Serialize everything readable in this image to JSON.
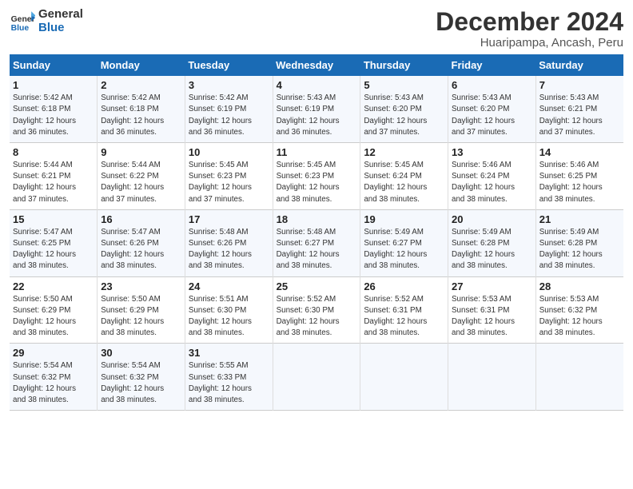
{
  "header": {
    "logo_line1": "General",
    "logo_line2": "Blue",
    "month_title": "December 2024",
    "location": "Huaripampa, Ancash, Peru"
  },
  "days_of_week": [
    "Sunday",
    "Monday",
    "Tuesday",
    "Wednesday",
    "Thursday",
    "Friday",
    "Saturday"
  ],
  "weeks": [
    [
      {
        "day": "1",
        "info": "Sunrise: 5:42 AM\nSunset: 6:18 PM\nDaylight: 12 hours\nand 36 minutes."
      },
      {
        "day": "2",
        "info": "Sunrise: 5:42 AM\nSunset: 6:18 PM\nDaylight: 12 hours\nand 36 minutes."
      },
      {
        "day": "3",
        "info": "Sunrise: 5:42 AM\nSunset: 6:19 PM\nDaylight: 12 hours\nand 36 minutes."
      },
      {
        "day": "4",
        "info": "Sunrise: 5:43 AM\nSunset: 6:19 PM\nDaylight: 12 hours\nand 36 minutes."
      },
      {
        "day": "5",
        "info": "Sunrise: 5:43 AM\nSunset: 6:20 PM\nDaylight: 12 hours\nand 37 minutes."
      },
      {
        "day": "6",
        "info": "Sunrise: 5:43 AM\nSunset: 6:20 PM\nDaylight: 12 hours\nand 37 minutes."
      },
      {
        "day": "7",
        "info": "Sunrise: 5:43 AM\nSunset: 6:21 PM\nDaylight: 12 hours\nand 37 minutes."
      }
    ],
    [
      {
        "day": "8",
        "info": "Sunrise: 5:44 AM\nSunset: 6:21 PM\nDaylight: 12 hours\nand 37 minutes."
      },
      {
        "day": "9",
        "info": "Sunrise: 5:44 AM\nSunset: 6:22 PM\nDaylight: 12 hours\nand 37 minutes."
      },
      {
        "day": "10",
        "info": "Sunrise: 5:45 AM\nSunset: 6:23 PM\nDaylight: 12 hours\nand 37 minutes."
      },
      {
        "day": "11",
        "info": "Sunrise: 5:45 AM\nSunset: 6:23 PM\nDaylight: 12 hours\nand 38 minutes."
      },
      {
        "day": "12",
        "info": "Sunrise: 5:45 AM\nSunset: 6:24 PM\nDaylight: 12 hours\nand 38 minutes."
      },
      {
        "day": "13",
        "info": "Sunrise: 5:46 AM\nSunset: 6:24 PM\nDaylight: 12 hours\nand 38 minutes."
      },
      {
        "day": "14",
        "info": "Sunrise: 5:46 AM\nSunset: 6:25 PM\nDaylight: 12 hours\nand 38 minutes."
      }
    ],
    [
      {
        "day": "15",
        "info": "Sunrise: 5:47 AM\nSunset: 6:25 PM\nDaylight: 12 hours\nand 38 minutes."
      },
      {
        "day": "16",
        "info": "Sunrise: 5:47 AM\nSunset: 6:26 PM\nDaylight: 12 hours\nand 38 minutes."
      },
      {
        "day": "17",
        "info": "Sunrise: 5:48 AM\nSunset: 6:26 PM\nDaylight: 12 hours\nand 38 minutes."
      },
      {
        "day": "18",
        "info": "Sunrise: 5:48 AM\nSunset: 6:27 PM\nDaylight: 12 hours\nand 38 minutes."
      },
      {
        "day": "19",
        "info": "Sunrise: 5:49 AM\nSunset: 6:27 PM\nDaylight: 12 hours\nand 38 minutes."
      },
      {
        "day": "20",
        "info": "Sunrise: 5:49 AM\nSunset: 6:28 PM\nDaylight: 12 hours\nand 38 minutes."
      },
      {
        "day": "21",
        "info": "Sunrise: 5:49 AM\nSunset: 6:28 PM\nDaylight: 12 hours\nand 38 minutes."
      }
    ],
    [
      {
        "day": "22",
        "info": "Sunrise: 5:50 AM\nSunset: 6:29 PM\nDaylight: 12 hours\nand 38 minutes."
      },
      {
        "day": "23",
        "info": "Sunrise: 5:50 AM\nSunset: 6:29 PM\nDaylight: 12 hours\nand 38 minutes."
      },
      {
        "day": "24",
        "info": "Sunrise: 5:51 AM\nSunset: 6:30 PM\nDaylight: 12 hours\nand 38 minutes."
      },
      {
        "day": "25",
        "info": "Sunrise: 5:52 AM\nSunset: 6:30 PM\nDaylight: 12 hours\nand 38 minutes."
      },
      {
        "day": "26",
        "info": "Sunrise: 5:52 AM\nSunset: 6:31 PM\nDaylight: 12 hours\nand 38 minutes."
      },
      {
        "day": "27",
        "info": "Sunrise: 5:53 AM\nSunset: 6:31 PM\nDaylight: 12 hours\nand 38 minutes."
      },
      {
        "day": "28",
        "info": "Sunrise: 5:53 AM\nSunset: 6:32 PM\nDaylight: 12 hours\nand 38 minutes."
      }
    ],
    [
      {
        "day": "29",
        "info": "Sunrise: 5:54 AM\nSunset: 6:32 PM\nDaylight: 12 hours\nand 38 minutes."
      },
      {
        "day": "30",
        "info": "Sunrise: 5:54 AM\nSunset: 6:32 PM\nDaylight: 12 hours\nand 38 minutes."
      },
      {
        "day": "31",
        "info": "Sunrise: 5:55 AM\nSunset: 6:33 PM\nDaylight: 12 hours\nand 38 minutes."
      },
      {
        "day": "",
        "info": ""
      },
      {
        "day": "",
        "info": ""
      },
      {
        "day": "",
        "info": ""
      },
      {
        "day": "",
        "info": ""
      }
    ]
  ]
}
